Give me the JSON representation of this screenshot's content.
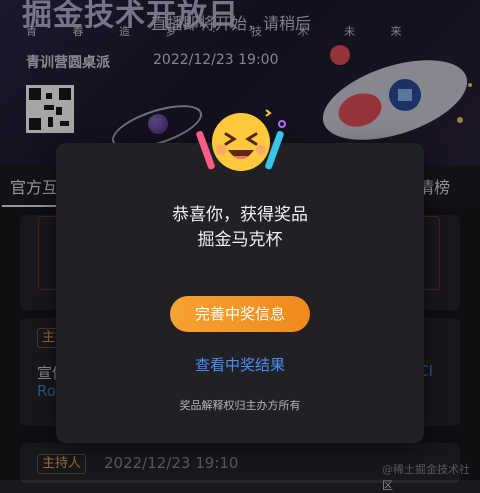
{
  "banner": {
    "title": "掘金技术开放日",
    "subtitle": "青 春 造 梦 · 技 术 未 来",
    "live_notice": "直播即将开始，请稍后",
    "host": "青训营圆桌派",
    "datetime": "2022/12/23  19:00"
  },
  "tabs": {
    "left": "官方互",
    "right": "情榜"
  },
  "cards": {
    "tag1": "主持",
    "text": "宣传",
    "link": "Ro",
    "link_right": "CI",
    "tag2": "主持人",
    "date": "2022/12/23 19:10"
  },
  "modal": {
    "congrats": "恭喜你，获得奖品",
    "prize_name": "掘金马克杯",
    "complete_button": "完善中奖信息",
    "view_result": "查看中奖结果",
    "rights": "奖品解释权归主办方所有"
  },
  "watermark": "@稀土掘金技术社区",
  "colors": {
    "accent_orange": "#f7a233",
    "link_blue": "#4d8cf5",
    "modal_bg": "#212125"
  }
}
